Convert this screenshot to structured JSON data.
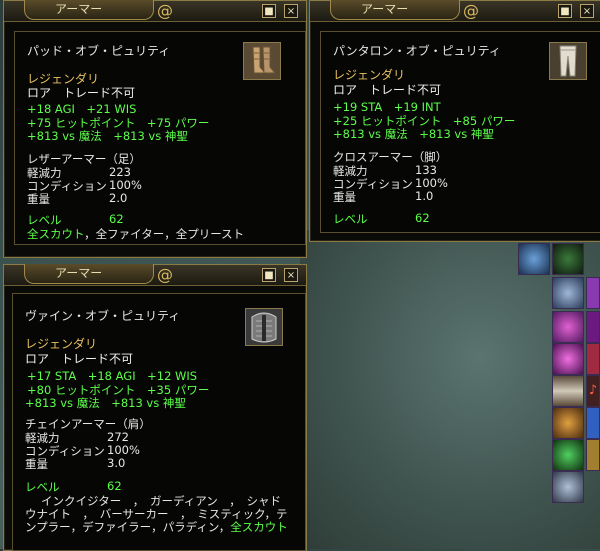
{
  "windows": [
    {
      "title": "アーマー",
      "item_name": "パッド・オブ・ピュリティ",
      "rarity": "レジェンダリ",
      "flags": "ロア　トレード不可",
      "stats_line1": "+18 AGI　+21 WIS",
      "stats_line2": "+75 ヒットポイント　+75 パワー",
      "stats_line3": "+813 vs 魔法　+813 vs 神聖",
      "armor_type": "レザーアーマー（足）",
      "props": [
        {
          "label": "軽減力",
          "value": "223"
        },
        {
          "label": "コンディション",
          "value": "100%"
        },
        {
          "label": "重量",
          "value": "2.0"
        }
      ],
      "level_label": "レベル",
      "level_value": "62",
      "classes_green": "全スカウト",
      "classes_white": "，全ファイター，全プリースト"
    },
    {
      "title": "アーマー",
      "item_name": "パンタロン・オブ・ピュリティ",
      "rarity": "レジェンダリ",
      "flags": "ロア　トレード不可",
      "stats_line1": "+19 STA　+19 INT",
      "stats_line2": "+25 ヒットポイント　+85 パワー",
      "stats_line3": "+813 vs 魔法　+813 vs 神聖",
      "armor_type": "クロスアーマー（脚）",
      "props": [
        {
          "label": "軽減力",
          "value": "133"
        },
        {
          "label": "コンディション",
          "value": "100%"
        },
        {
          "label": "重量",
          "value": "1.0"
        }
      ],
      "level_label": "レベル",
      "level_value": "62"
    },
    {
      "title": "アーマー",
      "item_name": "ヴァイン・オブ・ピュリティ",
      "rarity": "レジェンダリ",
      "flags": "ロア　トレード不可",
      "stats_line1": "+17 STA　+18 AGI　+12 WIS",
      "stats_line2": "+80 ヒットポイント　+35 パワー",
      "stats_line3": "+813 vs 魔法　+813 vs 神聖",
      "armor_type": "チェインアーマー（肩）",
      "props": [
        {
          "label": "軽減力",
          "value": "272"
        },
        {
          "label": "コンディション",
          "value": "100%"
        },
        {
          "label": "重量",
          "value": "3.0"
        }
      ],
      "level_label": "レベル",
      "level_value": "62",
      "classes_line1": "インクイジター　，　ガーディアン　，　シャド",
      "classes_line2": "ウナイト　，　バーサーカー　，　ミスティック，テ",
      "classes_line3_white": "ンプラー，デファイラー，パラディン，",
      "classes_line3_green": "全スカウト"
    }
  ],
  "buttons": {
    "minimize": "■",
    "close": "×"
  },
  "icons": {
    "title_swirl": "@"
  },
  "colors": {
    "bonus_green": "#5cff4a",
    "legendary_gold": "#e8c060",
    "frame_gold": "#8a7a44"
  }
}
